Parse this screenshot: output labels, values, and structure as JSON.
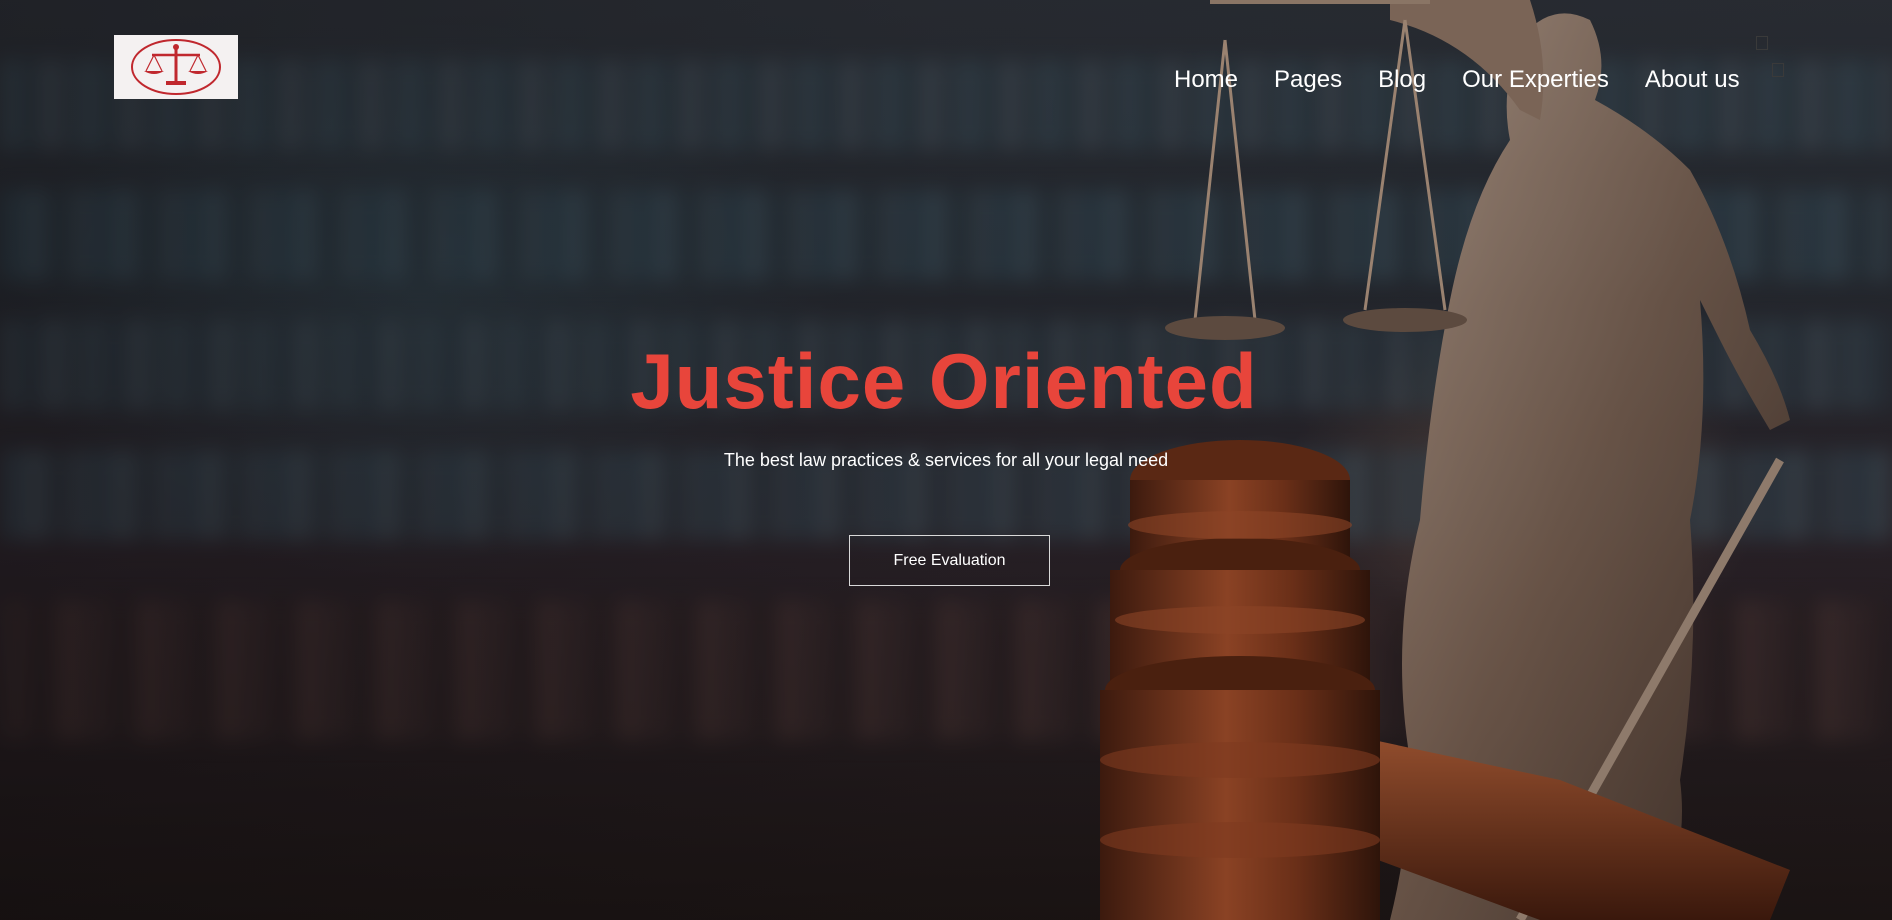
{
  "header": {
    "logo_name": "scales-of-justice-logo",
    "nav": [
      {
        "label": "Home"
      },
      {
        "label": "Pages"
      },
      {
        "label": "Blog"
      },
      {
        "label": "Our Experties"
      },
      {
        "label": "About us"
      }
    ],
    "icons": [
      "missing-glyph-icon",
      "missing-glyph-icon"
    ]
  },
  "hero": {
    "headline": "Justice Oriented",
    "subtitle": "The best law practices & services for all your legal need",
    "cta_label": "Free Evaluation"
  },
  "colors": {
    "headline": "#e8453b",
    "logo_red": "#c0282e",
    "text": "#ffffff"
  }
}
